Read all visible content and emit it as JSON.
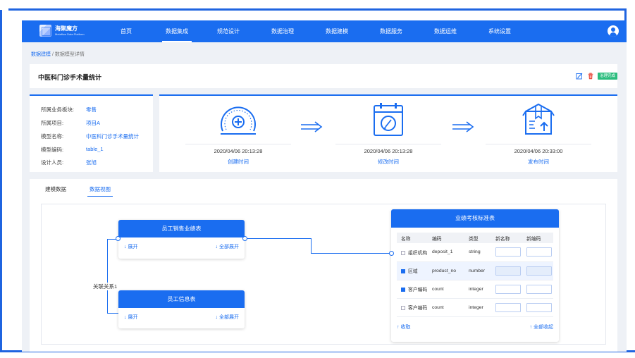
{
  "app": {
    "logo_title": "海聚魔方",
    "logo_subtitle": "Metaflow Data Platform",
    "nav": [
      "首页",
      "数据集成",
      "规范设计",
      "数据治理",
      "数据建模",
      "数据服务",
      "数据运维",
      "系统设置"
    ],
    "nav_active": "数据集成"
  },
  "breadcrumb": {
    "parent": "数据建模",
    "separator": " / ",
    "current": "数据模型详情"
  },
  "header": {
    "title": "中医科门诊手术量统计",
    "status": "治理完成"
  },
  "info": {
    "rows": [
      {
        "label": "所属业务板块:",
        "value": "零售"
      },
      {
        "label": "所属项目:",
        "value": "项目A"
      },
      {
        "label": "模型名称:",
        "value": "中医科门诊手术量统计"
      },
      {
        "label": "模型编码:",
        "value": "table_1"
      },
      {
        "label": "设计人员:",
        "value": "张旭"
      }
    ]
  },
  "timeline": [
    {
      "icon": "speedometer-icon",
      "date": "2020/04/06 20:13:28",
      "label": "创建时间"
    },
    {
      "icon": "calendar-edit-icon",
      "date": "2020/04/06 20:13:28",
      "label": "修改时间"
    },
    {
      "icon": "package-upload-icon",
      "date": "2020/04/06 20:33:00",
      "label": "发布时间"
    }
  ],
  "tabs": [
    "建模数据",
    "数据视图"
  ],
  "tab_active": "数据视图",
  "diagram": {
    "relation_label": "关联关系1",
    "sales_table": {
      "title": "员工销售业绩表",
      "expand": "展开",
      "expand_all": "全部展开"
    },
    "staff_table": {
      "title": "员工信息表",
      "expand": "展开",
      "expand_all": "全部展开"
    },
    "standard_table": {
      "title": "业绩考核标准表",
      "columns": [
        "名称",
        "编码",
        "类型",
        "新名称",
        "新编码"
      ],
      "rows": [
        {
          "name": "组织机构",
          "code": "deposit_1",
          "type": "string",
          "checked": false,
          "highlight": false
        },
        {
          "name": "区域",
          "code": "product_no",
          "type": "number",
          "checked": true,
          "highlight": true
        },
        {
          "name": "客户编码",
          "code": "count",
          "type": "integer",
          "checked": true,
          "highlight": false
        },
        {
          "name": "客户编码",
          "code": "count",
          "type": "integer",
          "checked": false,
          "highlight": false
        }
      ],
      "collapse": "收取",
      "collapse_all": "全部收起"
    }
  },
  "colors": {
    "primary": "#1a6df0",
    "success": "#2bbd7e",
    "background": "#eef1f6"
  }
}
